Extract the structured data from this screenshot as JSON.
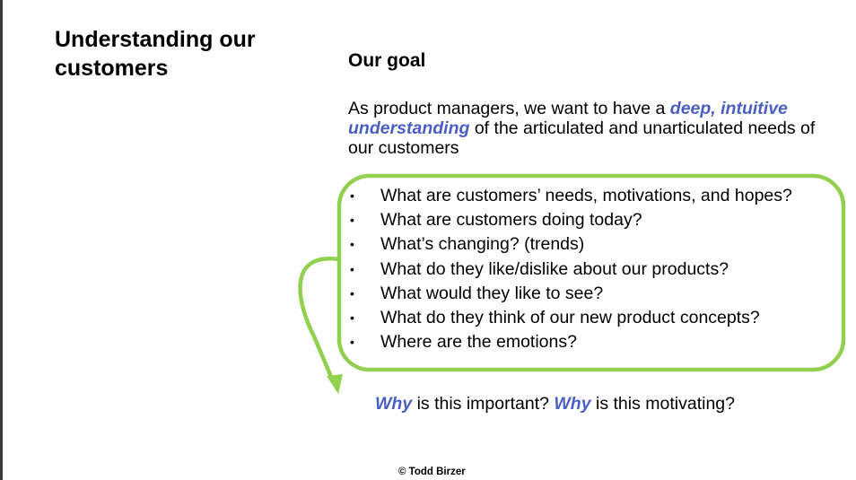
{
  "slide": {
    "title": "Understanding our\ncustomers",
    "goal_heading": "Our goal",
    "intro": {
      "before": "As product managers, we want to have a ",
      "emphasis": "deep, intuitive understanding",
      "after": " of the articulated and unarticulated needs of our customers"
    },
    "bullets": [
      "What are customers’ needs, motivations, and hopes?",
      "What are customers doing today?",
      "What’s changing? (trends)",
      "What do they like/dislike about our products?",
      "What would they like to see?",
      "What do they think of our new product concepts?",
      "Where are the emotions?"
    ],
    "bullet_symbol": "•",
    "why_line": {
      "why1": "Why",
      "mid": " is this important? ",
      "why2": "Why",
      "end": " is this motivating?"
    },
    "footer": "© Todd Birzer",
    "colors": {
      "emphasis": "#4a5fc1",
      "highlight_box": "#92d050"
    }
  }
}
